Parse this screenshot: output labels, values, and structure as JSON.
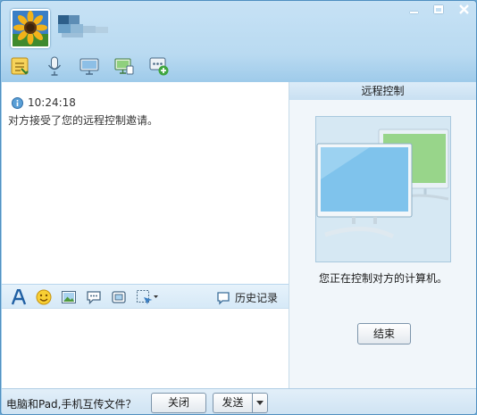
{
  "header": {
    "contact_name": "",
    "window_controls": [
      "minimize",
      "maximize",
      "close"
    ]
  },
  "toolbar": {
    "items": [
      {
        "icon": "file-transfer-icon"
      },
      {
        "icon": "microphone-icon"
      },
      {
        "icon": "video-icon"
      },
      {
        "icon": "remote-desktop-icon"
      },
      {
        "icon": "more-apps-icon"
      }
    ]
  },
  "chat": {
    "message": {
      "time": "10:24:18",
      "text": "对方接受了您的远程控制邀请。"
    }
  },
  "format_bar": {
    "icons": [
      "font-icon",
      "emoji-icon",
      "image-icon",
      "bubble-icon",
      "screenshot-icon",
      "screen-capture-dropdown-icon"
    ],
    "history_label": "历史记录"
  },
  "remote_panel": {
    "title": "远程控制",
    "status": "您正在控制对方的计算机。",
    "end_button": "结束"
  },
  "bottom_bar": {
    "link_text": "电脑和Pad,手机互传文件？",
    "close_button": "关闭",
    "send_button": "发送"
  },
  "colors": {
    "window_accent": "#9fcbea",
    "panel_title": "#c9e0f2"
  }
}
